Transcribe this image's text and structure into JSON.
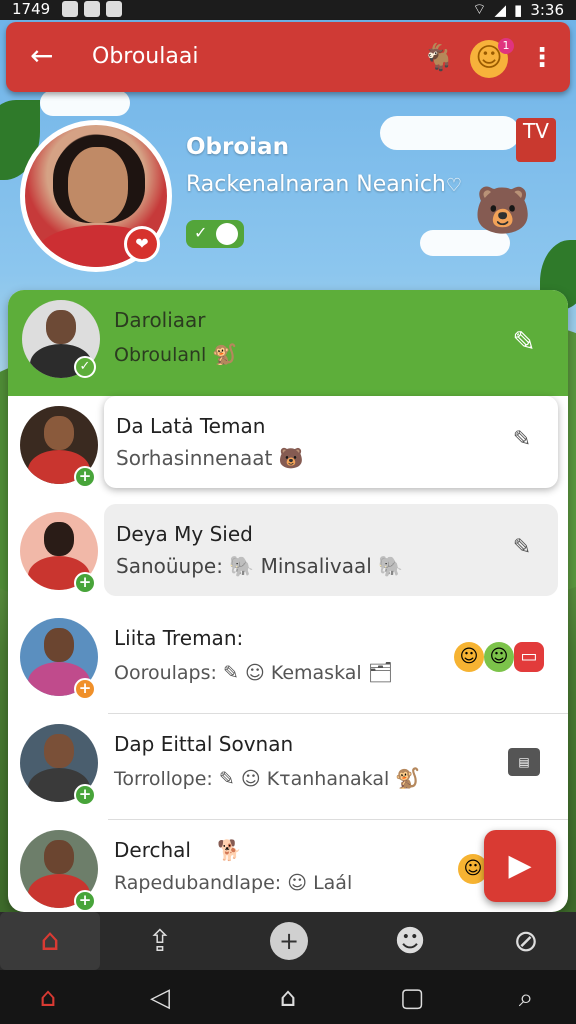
{
  "status_bar": {
    "time": "1749",
    "clock": "3:36"
  },
  "app_bar": {
    "title": "Obroulaai",
    "notification_count": "1",
    "icons": [
      "back-arrow-icon",
      "dog-icon",
      "smiley-icon",
      "more-vert-icon"
    ]
  },
  "profile": {
    "name": "Obroian",
    "subtitle": "Rackenalnaran Neanich",
    "subtitle_icon": "heart-icon",
    "toggle_on": true,
    "tv_label": "TV"
  },
  "contacts": [
    {
      "name": "Daroliaar",
      "status": "Obroulanl",
      "emoji": "🐒",
      "highlighted": true
    },
    {
      "name": "Da Latȧ Teman",
      "status": "Sorhasinnenaat",
      "emoji": "🐻",
      "style": "white-popover"
    },
    {
      "name": "Deya My Sied",
      "status_prefix": "Sanoüupe:",
      "status": "Minsalivaal",
      "emoji_left": "🐘",
      "emoji_right": "🐘",
      "style": "grey-popover"
    },
    {
      "name": "Liita Treman:",
      "status_prefix": "Ooroulaps:",
      "status": "Kemaskal",
      "emoji_right": "🗂"
    },
    {
      "name": "Dap Eittal Sovnan",
      "status_prefix": "Torrollope:",
      "status": "Kτanhanakal",
      "emoji_right": "🐒"
    },
    {
      "name": "Derchal",
      "name_emoji": "🐕",
      "status_prefix": "Rapedubandlape:",
      "status": "Laál"
    }
  ],
  "bottom_nav": [
    "home-icon",
    "share-icon",
    "add-icon",
    "profile-icon",
    "compass-icon"
  ],
  "system_nav": [
    "home-icon",
    "back-icon",
    "home-outline-icon",
    "recents-icon",
    "search-icon"
  ],
  "colors": {
    "accent_red": "#cf3a35",
    "accent_green": "#5dae3a",
    "text_green": "#47a235"
  }
}
